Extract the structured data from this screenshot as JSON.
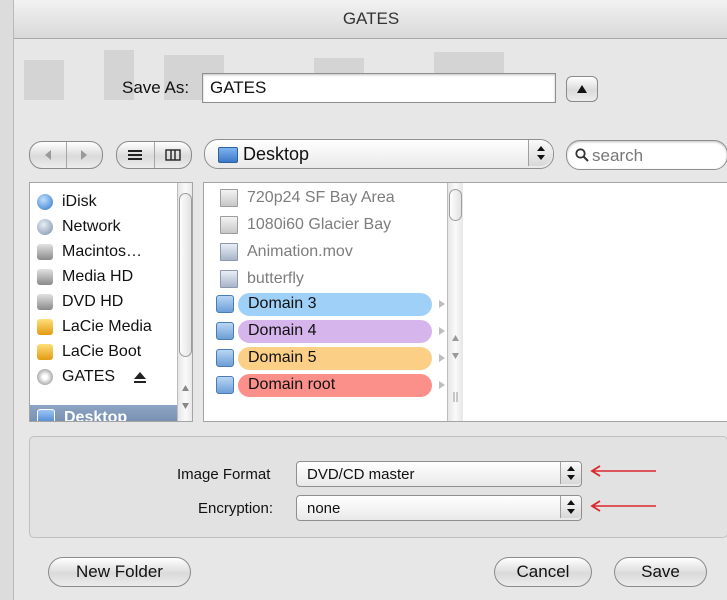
{
  "window": {
    "title": "GATES"
  },
  "save_as": {
    "label": "Save As:",
    "value": "GATES"
  },
  "toolbar": {
    "back_icon": "chevron-left-icon",
    "forward_icon": "chevron-right-icon",
    "list_view_icon": "list-view-icon",
    "column_view_icon": "column-view-icon",
    "location": "Desktop",
    "search_placeholder": "search"
  },
  "sidebar": {
    "items": [
      {
        "label": "iDisk",
        "icon": "idisk-icon"
      },
      {
        "label": "Network",
        "icon": "network-icon"
      },
      {
        "label": "Macintos…",
        "icon": "hard-drive-icon"
      },
      {
        "label": "Media HD",
        "icon": "hard-drive-icon"
      },
      {
        "label": "DVD HD",
        "icon": "hard-drive-icon"
      },
      {
        "label": "LaCie Media",
        "icon": "external-drive-icon"
      },
      {
        "label": "LaCie Boot",
        "icon": "external-drive-icon"
      },
      {
        "label": "GATES",
        "icon": "disk-image-icon"
      },
      {
        "label": "Desktop",
        "icon": "desktop-folder-icon"
      }
    ]
  },
  "files": {
    "items": [
      {
        "label": "720p24 SF Bay Area",
        "enabled": false
      },
      {
        "label": "1080i60 Glacier Bay",
        "enabled": false
      },
      {
        "label": "Animation.mov",
        "enabled": false
      },
      {
        "label": "butterfly",
        "enabled": false
      },
      {
        "label": "Domain 3",
        "enabled": true,
        "color": "#9fd0f7"
      },
      {
        "label": "Domain 4",
        "enabled": true,
        "color": "#d6b4ec"
      },
      {
        "label": "Domain 5",
        "enabled": true,
        "color": "#fccf86"
      },
      {
        "label": "Domain root",
        "enabled": true,
        "color": "#fb8f8a"
      }
    ]
  },
  "options": {
    "image_format_label": "Image Format",
    "image_format_value": "DVD/CD master",
    "encryption_label": "Encryption:",
    "encryption_value": "none",
    "annotation_color": "#d9272e"
  },
  "buttons": {
    "new_folder": "New Folder",
    "cancel": "Cancel",
    "save": "Save"
  }
}
